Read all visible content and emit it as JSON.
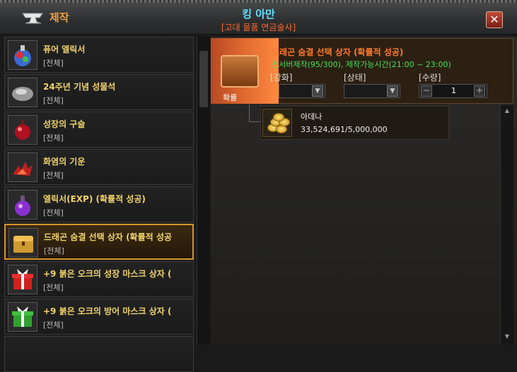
{
  "window": {
    "title": "제작",
    "close_label": "✕"
  },
  "npc": {
    "name": "킹 아만",
    "subtitle": "[고대 물품 연금술사]"
  },
  "items": [
    {
      "name": "퓨어 엘릭서",
      "category": "[전체]"
    },
    {
      "name": "24주년 기념 성물석",
      "category": "[전체]"
    },
    {
      "name": "성장의 구슬",
      "category": "[전체]"
    },
    {
      "name": "화염의 기운",
      "category": "[전체]"
    },
    {
      "name": "엘릭서(EXP) (확률적 성공)",
      "category": "[전체]"
    },
    {
      "name": "드래곤 숨결 선택 상자 (확률적 성공",
      "category": "[전체]",
      "selected": true
    },
    {
      "name": "+9 붉은 오크의 성장 마스크 상자 (",
      "category": "[전체]"
    },
    {
      "name": "+9 붉은 오크의 방어 마스크 상자 (",
      "category": "[전체]"
    }
  ],
  "detail": {
    "thumb_label": "확률",
    "title": "드래곤 숨결 선택 상자 (확률적 성공)",
    "info": "전서버제작(95/300), 제작가능시간(21:00 ~ 23:00)",
    "enchant_label": "[강화]",
    "status_label": "[상태]",
    "quantity_label": "[수량]",
    "quantity_value": "1",
    "minus": "−",
    "plus": "+"
  },
  "material": {
    "name": "아데나",
    "value": "33,524,691/5,000,000"
  },
  "colors": {
    "accent": "#e8a24a",
    "npc": "#5fe0ff",
    "success": "#48e05a",
    "selected_border": "#d6942a"
  }
}
